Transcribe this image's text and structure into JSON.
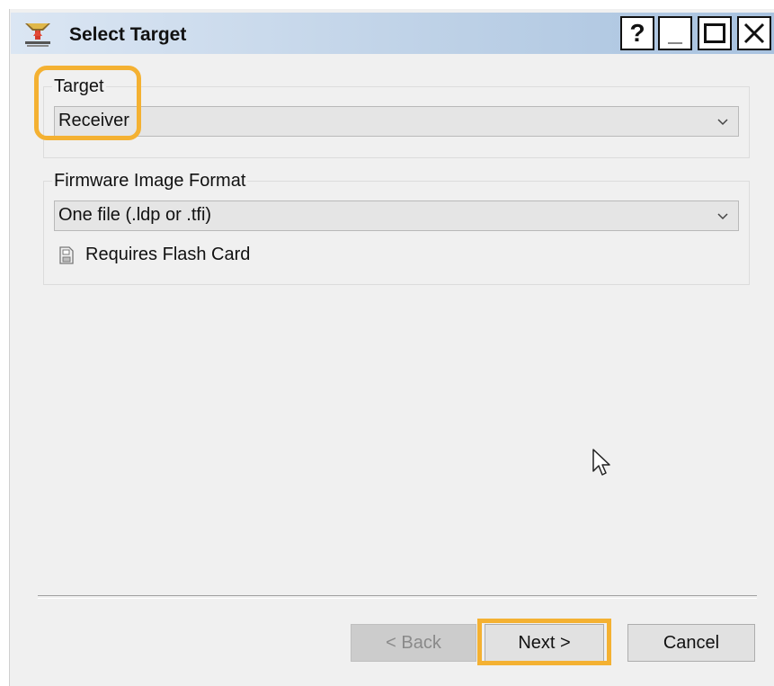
{
  "window": {
    "title": "Select Target",
    "app_icon": "receiver-antenna-icon",
    "controls": {
      "help": "?",
      "minimize": "_",
      "maximize": "maximize-icon",
      "close": "close-icon"
    }
  },
  "target_group": {
    "label": "Target",
    "value": "Receiver"
  },
  "firmware_group": {
    "label": "Firmware Image Format",
    "value": "One file (.ldp or .tfi)",
    "requirement_icon": "flash-card-icon",
    "requirement_label": "Requires Flash Card"
  },
  "buttons": {
    "back": "< Back",
    "next": "Next >",
    "cancel": "Cancel"
  },
  "colors": {
    "highlight": "#f4b132",
    "titlebar_start": "#dbe6f3",
    "titlebar_end": "#a8c2df",
    "dialog_bg": "#f0f0f0"
  }
}
